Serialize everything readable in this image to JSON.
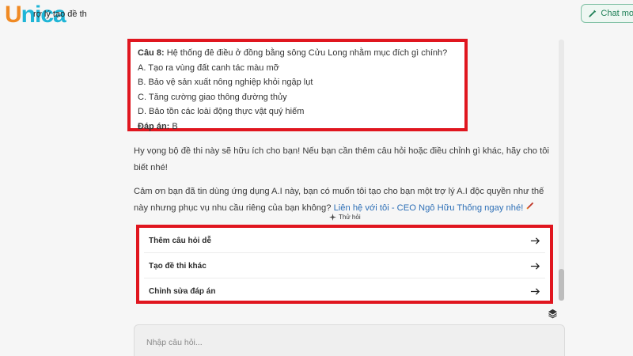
{
  "header": {
    "logo_u": "U",
    "logo_rest": "nica",
    "title": "rợ lý tạo đề th",
    "chat_button": "Chat mo"
  },
  "question": {
    "label": "Câu 8:",
    "text": "Hệ thống đê điều ở đồng bằng sông Cửu Long nhằm mục đích gì chính?",
    "options": [
      "A. Tạo ra vùng đất canh tác màu mỡ",
      "B. Bảo vệ sản xuất nông nghiệp khỏi ngập lụt",
      "C. Tăng cường giao thông đường thủy",
      "D. Bảo tồn các loài động thực vật quý hiếm"
    ],
    "answer_label": "Đáp án:",
    "answer": "B"
  },
  "messages": {
    "p1": "Hy vọng bộ đề thi này sẽ hữu ích cho bạn! Nếu bạn cần thêm câu hỏi hoặc điều chỉnh gì khác, hãy cho tôi biết nhé!",
    "p2": "Cảm ơn bạn đã tin dùng ứng dụng A.I này, bạn có muốn tôi tạo cho bạn một trợ lý A.I độc quyền như thế này nhưng phục vụ nhu cầu riêng của bạn không?",
    "link": "Liên hệ với tôi - CEO Ngô Hữu Thống ngay nhé!"
  },
  "suggestions": {
    "label": "Thử hỏi",
    "items": [
      "Thêm câu hỏi dễ",
      "Tạo đề thi khác",
      "Chỉnh sửa đáp án"
    ]
  },
  "input": {
    "placeholder": "Nhập câu hỏi..."
  },
  "colors": {
    "highlight": "#e0161f",
    "logo_orange": "#f08a24",
    "logo_blue": "#1fb5d6",
    "link": "#2d6fb6"
  }
}
